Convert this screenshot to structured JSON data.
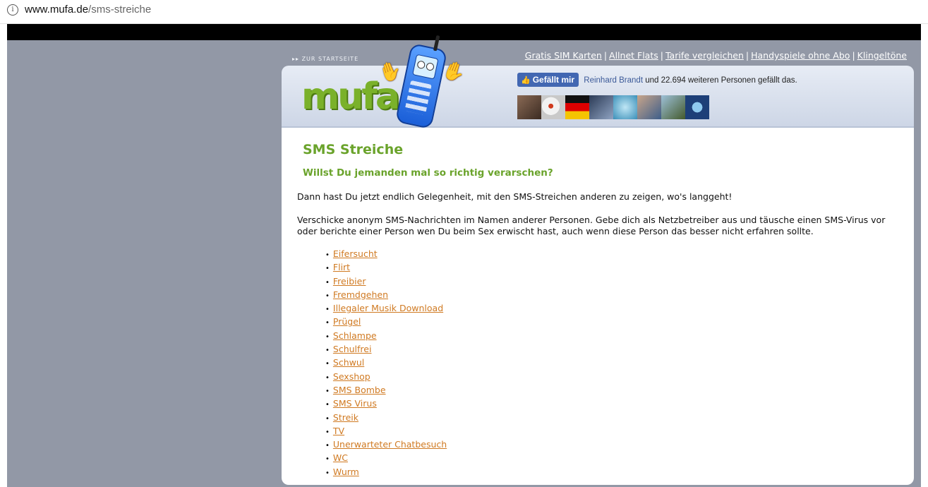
{
  "browser": {
    "url_domain": "www.mufa.de",
    "url_path": "/sms-streiche",
    "info_icon": "i"
  },
  "header": {
    "back_link": "▸▸ ZUR STARTSEITE",
    "nav_links": [
      {
        "label": "Gratis SIM Karten"
      },
      {
        "label": "Allnet Flats"
      },
      {
        "label": "Tarife vergleichen"
      },
      {
        "label": "Handyspiele ohne Abo"
      },
      {
        "label": "Klingeltöne"
      }
    ],
    "nav_separator": "|",
    "logo_text": "mufa",
    "facebook": {
      "like_label": "Gefällt mir",
      "thumb_icon": "thumbs-up-icon",
      "friend_name": "Reinhard Brandt",
      "rest_text": " und 22.694 weiteren Personen gefällt das."
    }
  },
  "main": {
    "title": "SMS Streiche",
    "subtitle": "Willst Du jemanden mal so richtig verarschen?",
    "intro": "Dann hast Du jetzt endlich Gelegenheit, mit den SMS-Streichen anderen zu zeigen, wo's langgeht!",
    "description": "Verschicke anonym SMS-Nachrichten im Namen anderer Personen. Gebe dich als Netzbetreiber aus und täusche einen SMS-Virus vor oder berichte einer Person wen Du beim Sex erwischt hast, auch wenn diese Person das besser nicht erfahren sollte.",
    "links": [
      "Eifersucht",
      "Flirt",
      "Freibier",
      "Fremdgehen",
      "Illegaler Musik Download",
      "Prügel",
      "Schlampe",
      "Schulfrei",
      "Schwul",
      "Sexshop",
      "SMS Bombe",
      "SMS Virus",
      "Streik",
      "TV",
      "Unerwarteter Chatbesuch",
      "WC",
      "Wurm"
    ]
  },
  "colors": {
    "accent_green": "#6aa32b",
    "link_orange": "#d07a22",
    "page_bg": "#9298a6",
    "fb_blue": "#4267b2"
  }
}
